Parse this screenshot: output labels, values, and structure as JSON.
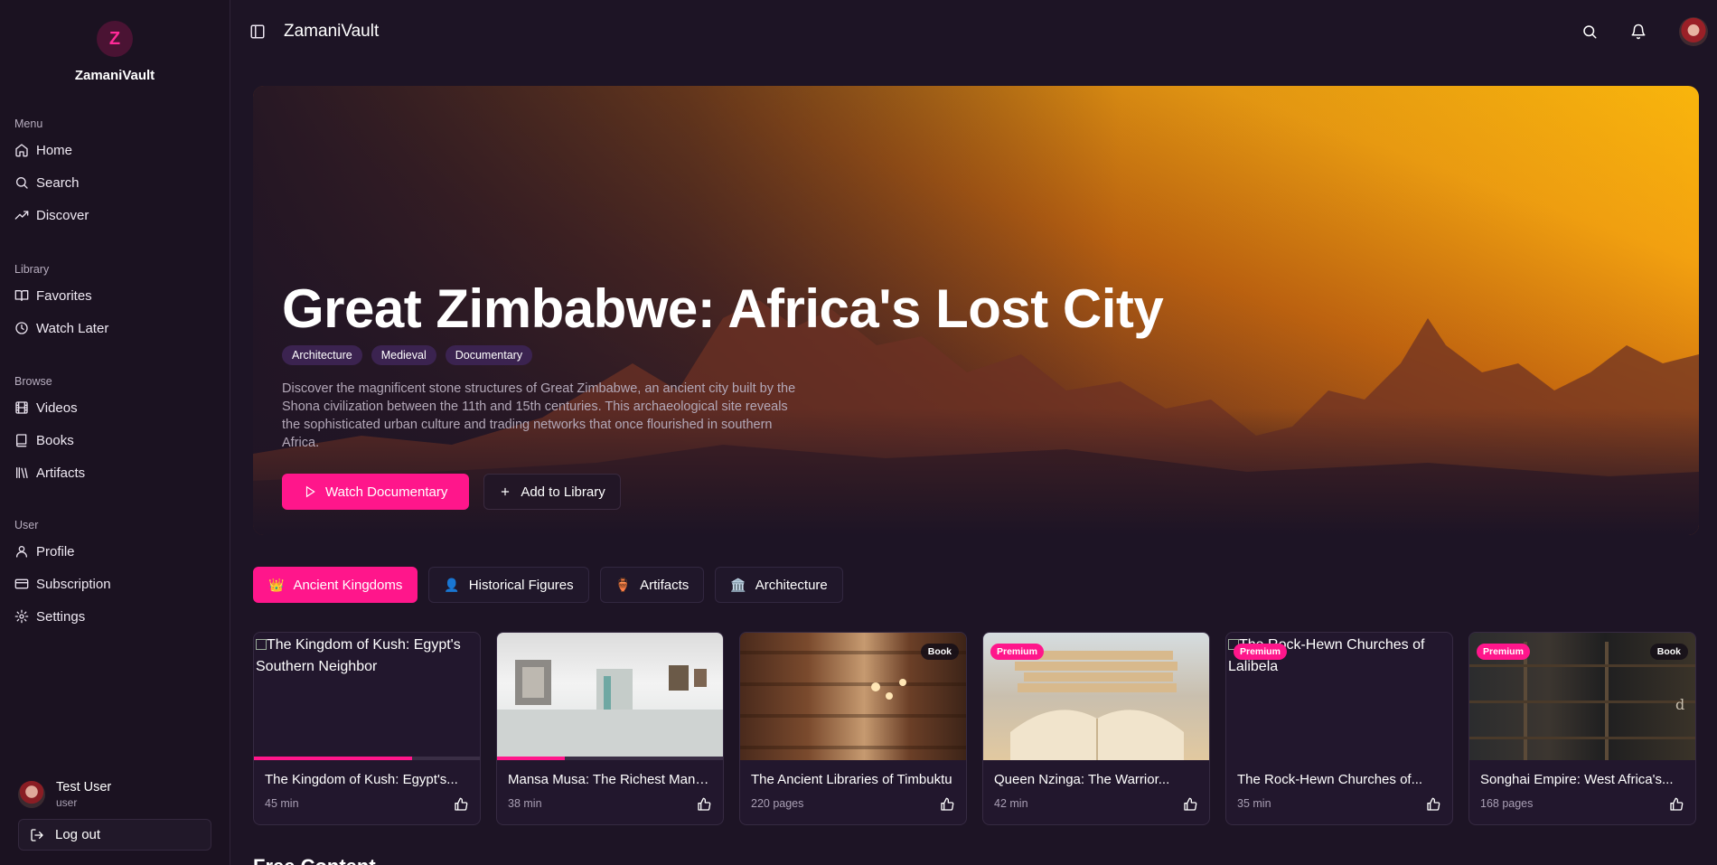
{
  "app": {
    "name": "ZamaniVault",
    "logo_letter": "Z"
  },
  "sidebar": {
    "sections": [
      {
        "heading": "Menu",
        "items": [
          {
            "label": "Home",
            "icon": "home-icon"
          },
          {
            "label": "Search",
            "icon": "search-icon"
          },
          {
            "label": "Discover",
            "icon": "trending-icon"
          }
        ]
      },
      {
        "heading": "Library",
        "items": [
          {
            "label": "Favorites",
            "icon": "book-open-icon"
          },
          {
            "label": "Watch Later",
            "icon": "clock-icon"
          }
        ]
      },
      {
        "heading": "Browse",
        "items": [
          {
            "label": "Videos",
            "icon": "film-icon"
          },
          {
            "label": "Books",
            "icon": "book-icon"
          },
          {
            "label": "Artifacts",
            "icon": "library-icon"
          }
        ]
      },
      {
        "heading": "User",
        "items": [
          {
            "label": "Profile",
            "icon": "user-icon"
          },
          {
            "label": "Subscription",
            "icon": "credit-card-icon"
          },
          {
            "label": "Settings",
            "icon": "gear-icon"
          }
        ]
      }
    ],
    "user": {
      "name": "Test User",
      "role": "user"
    },
    "logout_label": "Log out"
  },
  "header": {
    "title": "ZamaniVault"
  },
  "hero": {
    "title": "Great Zimbabwe: Africa's Lost City",
    "tags": [
      "Architecture",
      "Medieval",
      "Documentary"
    ],
    "description": "Discover the magnificent stone structures of Great Zimbabwe, an ancient city built by the Shona civilization between the 11th and 15th centuries. This archaeological site reveals the sophisticated urban culture and trading networks that once flourished in southern Africa.",
    "primary_label": "Watch Documentary",
    "secondary_label": "Add to Library"
  },
  "tabs": [
    {
      "label": "Ancient Kingdoms",
      "emoji": "👑",
      "active": true
    },
    {
      "label": "Historical Figures",
      "emoji": "👤",
      "active": false
    },
    {
      "label": "Artifacts",
      "emoji": "🏺",
      "active": false
    },
    {
      "label": "Architecture",
      "emoji": "🏛️",
      "active": false
    }
  ],
  "cards": [
    {
      "title": "The Kingdom of Kush: Egypt's Southern Neighbor",
      "display_title": "The Kingdom of Kush: Egypt's...",
      "meta": "45 min",
      "alt": "The Kingdom of Kush: Egypt's Southern Neighbor",
      "thumb": "broken",
      "progress": 0.7,
      "premium": false,
      "type": ""
    },
    {
      "title": "Mansa Musa: The Richest Man i...",
      "display_title": "Mansa Musa: The Richest Man i...",
      "meta": "38 min",
      "thumb": "gallery",
      "progress": 0.3,
      "premium": false,
      "type": ""
    },
    {
      "title": "The Ancient Libraries of Timbuktu",
      "display_title": "The Ancient Libraries of Timbuktu",
      "meta": "220 pages",
      "thumb": "library",
      "progress": 0,
      "premium": false,
      "type": "Book"
    },
    {
      "title": "Queen Nzinga: The Warrior...",
      "display_title": "Queen Nzinga: The Warrior...",
      "meta": "42 min",
      "thumb": "book",
      "progress": 0,
      "premium": true,
      "type": ""
    },
    {
      "title": "The Rock-Hewn Churches of Lalibela",
      "display_title": "The Rock-Hewn Churches of...",
      "meta": "35 min",
      "alt": "The Rock-Hewn Churches of Lalibela",
      "thumb": "broken",
      "progress": 0,
      "premium": true,
      "type": ""
    },
    {
      "title": "Songhai Empire: West Africa's...",
      "display_title": "Songhai Empire: West Africa's...",
      "meta": "168 pages",
      "thumb": "shelves",
      "progress": 0,
      "premium": true,
      "type": "Book"
    }
  ],
  "badges": {
    "premium": "Premium"
  },
  "next_section": {
    "title": "Free Content"
  },
  "colors": {
    "accent": "#ff168b",
    "background": "#1d1425",
    "sidebar": "#1b1221"
  }
}
